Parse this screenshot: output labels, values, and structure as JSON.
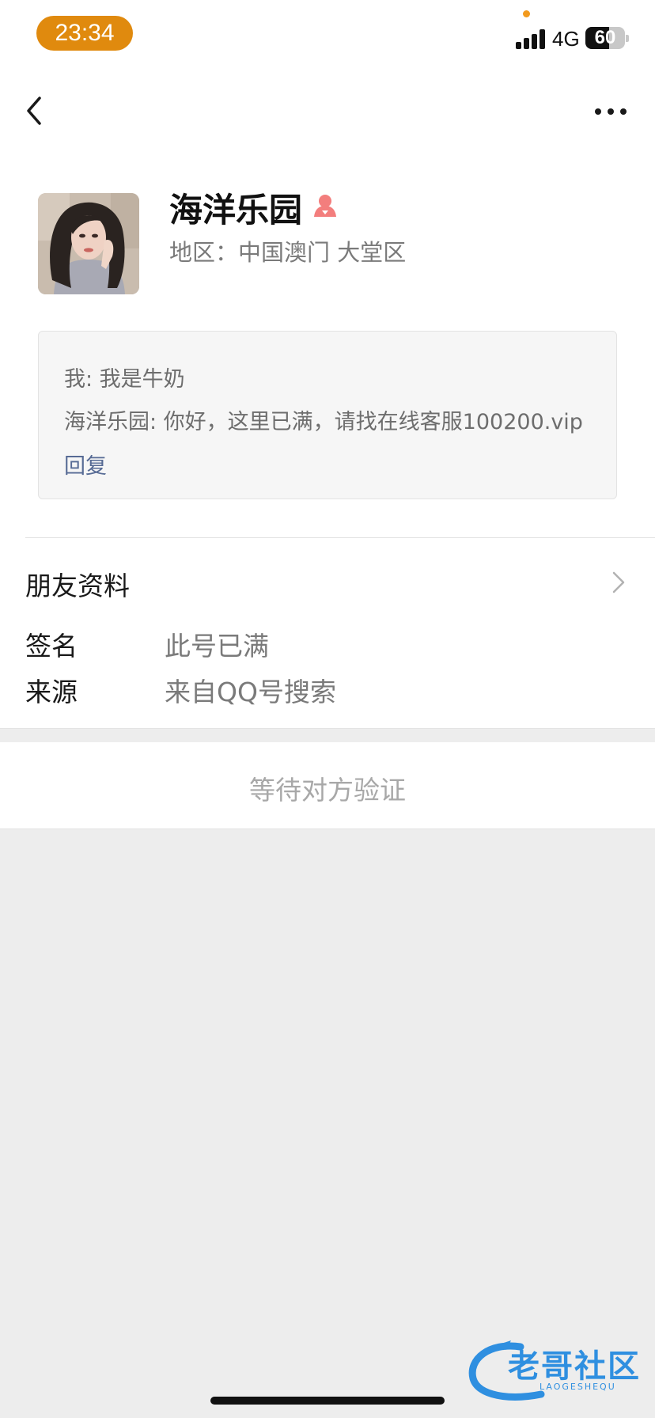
{
  "status_bar": {
    "time": "23:34",
    "network": "4G",
    "battery": "60",
    "battery_level": 0.6,
    "time_pill_color": "#e08a0e"
  },
  "nav": {
    "back_icon": "chevron-left-icon",
    "more_icon": "more-horizontal-icon"
  },
  "profile": {
    "nickname": "海洋乐园",
    "gender_icon": "female-icon",
    "gender_color": "#f37e7d",
    "region": "地区：中国澳门 大堂区"
  },
  "messages": {
    "line1": "我: 我是牛奶",
    "line2": "海洋乐园: 你好，这里已满，请找在线客服100200.vip",
    "reply_label": "回复",
    "link_color": "#576b95"
  },
  "friend_info": {
    "section_label": "朋友资料",
    "rows": [
      {
        "label": "签名",
        "value": "此号已满"
      },
      {
        "label": "来源",
        "value": "来自QQ号搜索"
      }
    ]
  },
  "action": {
    "waiting_label": "等待对方验证"
  },
  "watermark": {
    "title": "老哥社区",
    "subtitle": "LAOGESHEQU"
  }
}
